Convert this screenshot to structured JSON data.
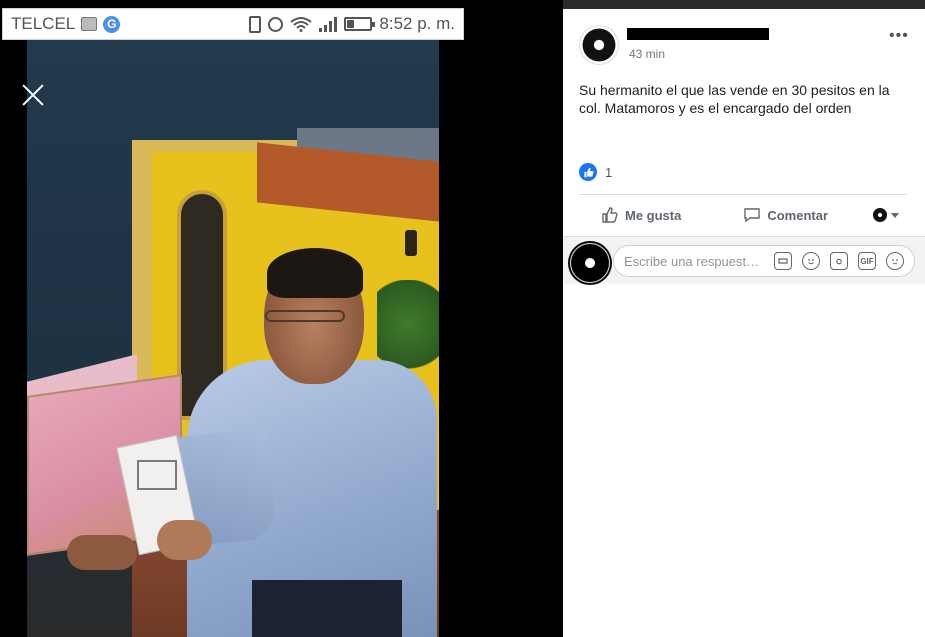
{
  "status_bar": {
    "carrier": "TELCEL",
    "time": "8:52 p. m.",
    "icons": [
      "image-icon",
      "google-icon",
      "vibrate-icon",
      "alarm-icon",
      "wifi-icon",
      "signal-icon",
      "battery-icon"
    ],
    "google_letter": "G"
  },
  "viewer": {
    "close_icon": "close-icon"
  },
  "post": {
    "author": "",
    "timestamp": "43 min",
    "text": "Su hermanito el que las vende en 30 pesitos en la col. Matamoros y es el encargado del orden",
    "reaction_count": "1",
    "more_label": "•••"
  },
  "actions": {
    "like": "Me gusta",
    "comment": "Comentar"
  },
  "comment_box": {
    "placeholder": "Escribe una respuest…",
    "icons": [
      "sticker-icon",
      "emoji-icon",
      "camera-icon",
      "gif-icon",
      "sticker-face-icon"
    ],
    "gif_label": "GIF"
  },
  "colors": {
    "brand_blue": "#1877f2",
    "panel_bg": "#ffffff",
    "comment_bg": "#f2f3f5",
    "muted_text": "#606770"
  }
}
